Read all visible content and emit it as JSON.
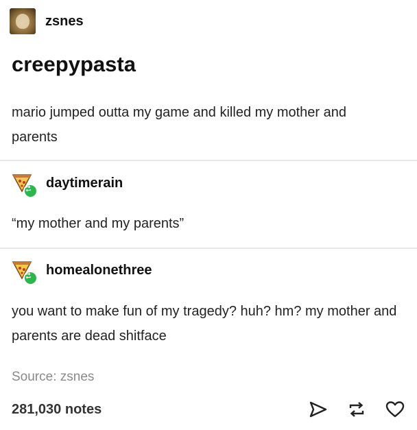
{
  "post": {
    "original_poster": {
      "username": "zsnes"
    },
    "title": "creepypasta",
    "body": "mario jumped outta my game and killed my mother and parents"
  },
  "reblogs": [
    {
      "username": "daytimerain",
      "text": "“my mother and my parents”"
    },
    {
      "username": "homealonethree",
      "text": "you want to make fun of my tragedy? huh? hm? my mother and parents are dead shitface"
    }
  ],
  "footer": {
    "source": "Source: zsnes",
    "notes": "281,030 notes",
    "actions": [
      "share-icon",
      "reblog-icon",
      "like-icon"
    ]
  },
  "colors": {
    "reblog_badge": "#2fb54e",
    "divider": "#e6e6e6",
    "muted_text": "#8a8a8a"
  }
}
